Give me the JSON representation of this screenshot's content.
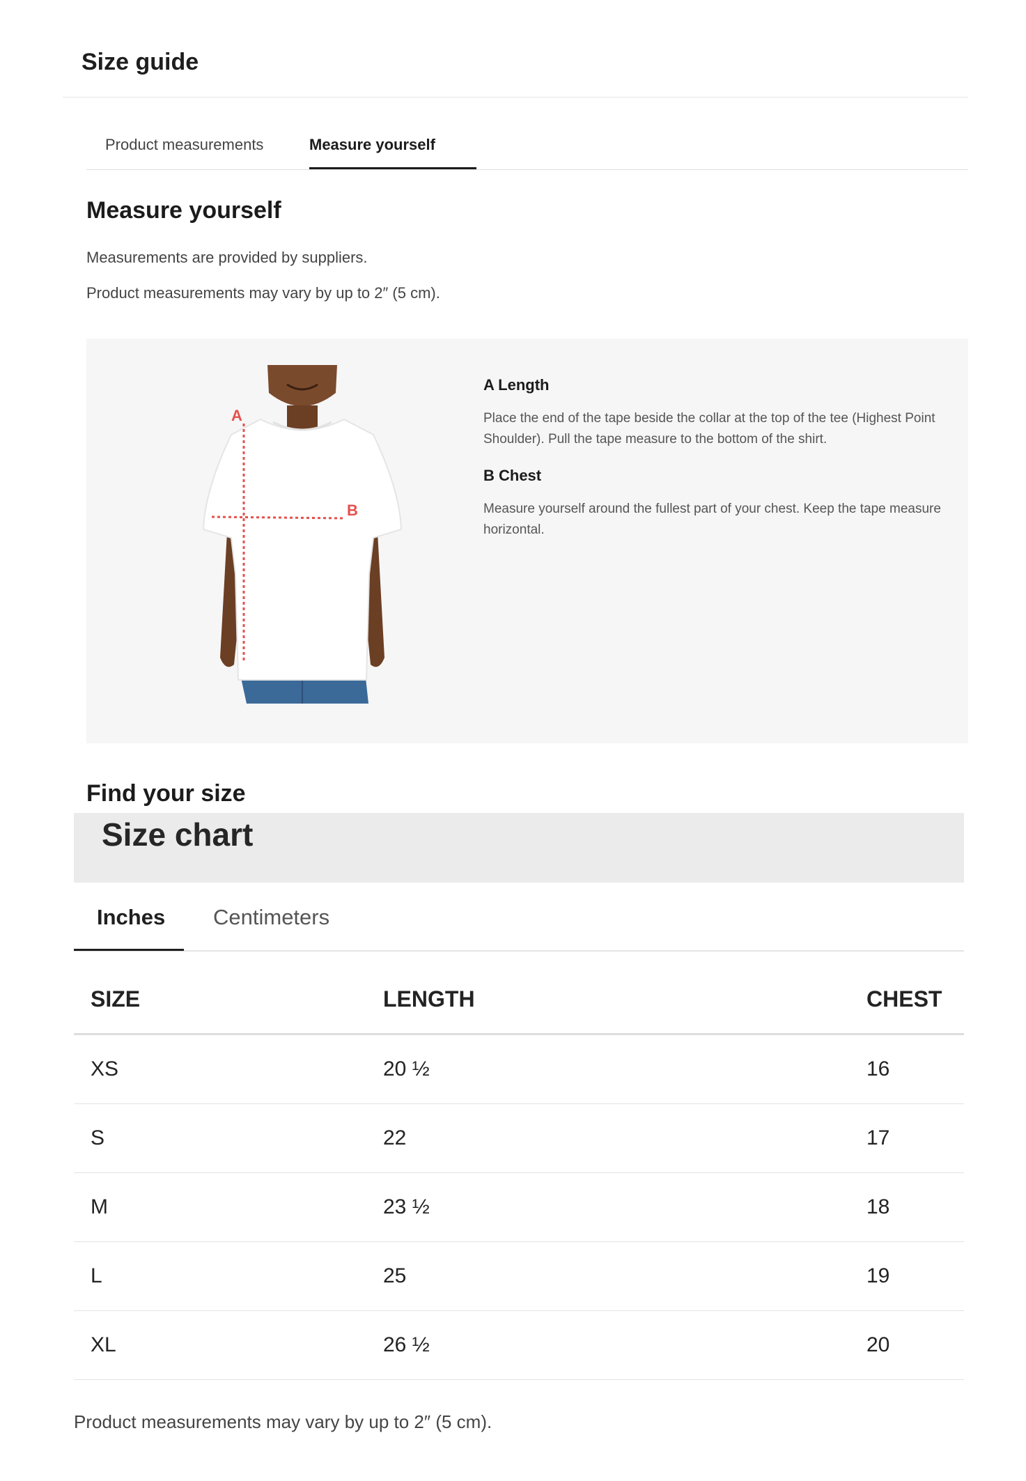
{
  "guide": {
    "title": "Size guide"
  },
  "tabs": [
    {
      "label": "Product measurements",
      "active": false
    },
    {
      "label": "Measure yourself",
      "active": true
    }
  ],
  "measure": {
    "heading": "Measure yourself",
    "note1": "Measurements are provided by suppliers.",
    "note2": "Product measurements may vary by up to 2″ (5 cm).",
    "figure_markers": {
      "a": "A",
      "b": "B"
    },
    "instructions": [
      {
        "title": "A Length",
        "text": "Place the end of the tape beside the collar at the top of the tee (Highest Point Shoulder). Pull the tape measure to the bottom of the shirt."
      },
      {
        "title": "B Chest",
        "text": "Measure yourself around the fullest part of your chest. Keep the tape measure horizontal."
      }
    ]
  },
  "find": {
    "heading": "Find your size"
  },
  "chart": {
    "title": "Size chart",
    "unit_tabs": [
      {
        "label": "Inches",
        "active": true
      },
      {
        "label": "Centimeters",
        "active": false
      }
    ],
    "columns": [
      "SIZE",
      "LENGTH",
      "CHEST"
    ],
    "rows": [
      [
        "XS",
        "20 ½",
        "16"
      ],
      [
        "S",
        "22",
        "17"
      ],
      [
        "M",
        "23 ½",
        "18"
      ],
      [
        "L",
        "25",
        "19"
      ],
      [
        "XL",
        "26 ½",
        "20"
      ]
    ]
  },
  "footnote": "Product measurements may vary by up to 2″ (5 cm).",
  "colors": {
    "marker": "#e4504c",
    "panel_bg": "#f6f6f6",
    "chart_bar_bg": "#ebebeb",
    "text": "#1f1f1f"
  }
}
